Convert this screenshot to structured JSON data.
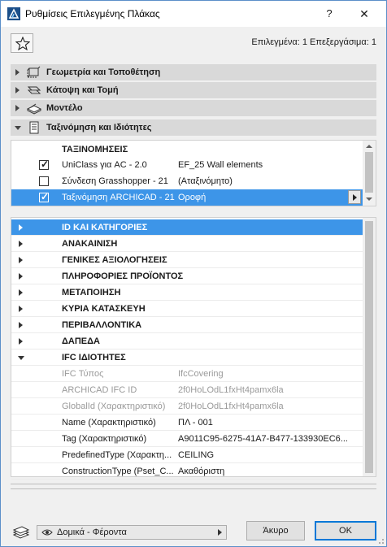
{
  "window": {
    "title": "Ρυθμίσεις Επιλεγμένης Πλάκας",
    "help_label": "?",
    "close_label": "✕"
  },
  "selection_info": "Επιλεγμένα: 1 Επεξεργάσιμα: 1",
  "sections": [
    {
      "label": "Γεωμετρία και Τοποθέτηση",
      "expanded": false,
      "icon": "slab-geometry-icon"
    },
    {
      "label": "Κάτοψη και Τομή",
      "expanded": false,
      "icon": "floor-plan-section-icon"
    },
    {
      "label": "Μοντέλο",
      "expanded": false,
      "icon": "model-icon"
    },
    {
      "label": "Ταξινόμηση και Ιδιότητες",
      "expanded": true,
      "icon": "document-icon"
    }
  ],
  "classifications": {
    "header": "ΤΑΞΙΝΟΜΗΣΕΙΣ",
    "rows": [
      {
        "name": "UniClass για AC - 2.0",
        "value": "EF_25 Wall elements",
        "checked": true,
        "selected": false
      },
      {
        "name": "Σύνδεση Grasshopper - 21",
        "value": "(Αταξινόμητο)",
        "checked": false,
        "selected": false
      },
      {
        "name": "Ταξινόμηση ARCHICAD - 21",
        "value": "Οροφή",
        "checked": true,
        "selected": true
      }
    ]
  },
  "property_groups": [
    {
      "label": "ID ΚΑΙ ΚΑΤΗΓΟΡΙΕΣ",
      "selected": true,
      "expanded": false
    },
    {
      "label": "ΑΝΑΚΑΙΝΙΣΗ",
      "selected": false,
      "expanded": false
    },
    {
      "label": "ΓΕΝΙΚΕΣ ΑΞΙΟΛΟΓΗΣΕΙΣ",
      "selected": false,
      "expanded": false
    },
    {
      "label": "ΠΛΗΡΟΦΟΡΙΕΣ ΠΡΟΪΟΝΤΟΣ",
      "selected": false,
      "expanded": false
    },
    {
      "label": "ΜΕΤΑΠΟΙΗΣΗ",
      "selected": false,
      "expanded": false
    },
    {
      "label": "ΚΥΡΙΑ ΚΑΤΑΣΚΕΥΗ",
      "selected": false,
      "expanded": false
    },
    {
      "label": "ΠΕΡΙΒΑΛΛΟΝΤΙΚΑ",
      "selected": false,
      "expanded": false
    },
    {
      "label": "ΔΑΠΕΔΑ",
      "selected": false,
      "expanded": false
    },
    {
      "label": "IFC ΙΔΙΟΤΗΤΕΣ",
      "selected": false,
      "expanded": true
    }
  ],
  "ifc_properties": [
    {
      "name": "IFC Τύπος",
      "value": "IfcCovering",
      "dim": true
    },
    {
      "name": "ARCHICAD IFC ID",
      "value": "2f0HoLOdL1fxHt4pamx6la",
      "dim": true
    },
    {
      "name": "GlobalId (Χαρακτηριστικό)",
      "value": "2f0HoLOdL1fxHt4pamx6la",
      "dim": true
    },
    {
      "name": "Name (Χαρακτηριστικό)",
      "value": "ΠΛ - 001",
      "dim": false
    },
    {
      "name": "Tag (Χαρακτηριστικό)",
      "value": "A9011C95-6275-41A7-B477-133930EC6...",
      "dim": false
    },
    {
      "name": "PredefinedType (Χαρακτη...",
      "value": "CEILING",
      "dim": false
    },
    {
      "name": "ConstructionType (Pset_C...",
      "value": "Ακαθόριστη",
      "dim": false
    }
  ],
  "footer": {
    "layer_value": "Δομικά - Φέροντα",
    "cancel_label": "Άκυρο",
    "ok_label": "OK"
  },
  "colors": {
    "selection": "#3d95e8",
    "section_header": "#d9d9d9",
    "ok_border": "#0078d7"
  }
}
